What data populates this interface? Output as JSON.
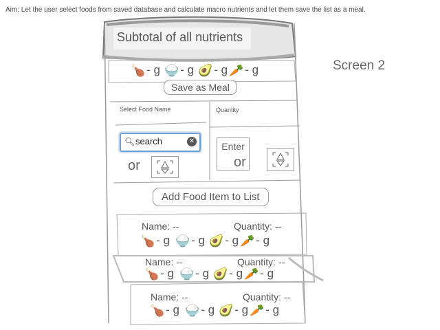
{
  "aim_text": "Aim: Let the user select foods from saved database and  calculate macro nutrients and let them save the list as a meal.",
  "screen_label": "Screen 2",
  "subtotal": {
    "title": "Subtotal   of all nutrients",
    "macros": [
      "- g",
      "- g",
      "- g",
      "- g"
    ]
  },
  "macro_icons": [
    "🍗",
    "🍚",
    "🥑",
    "🥕"
  ],
  "save_meal_label": "Save as Meal",
  "select_food_label": "Select Food  Name",
  "quantity_label": "Quantity",
  "search": {
    "placeholder": "search",
    "value": "search"
  },
  "or_label": "or",
  "enter_label": "Enter",
  "add_item_label": "Add Food Item to List",
  "food_items": [
    {
      "name_label": "Name:  --",
      "quantity_label": "Quantity: --",
      "macros": [
        "- g",
        "- g",
        "- g",
        "- g"
      ]
    },
    {
      "name_label": "Name:  --",
      "quantity_label": "Quantity: --",
      "macros": [
        "- g",
        "- g",
        "- g",
        "- g"
      ]
    },
    {
      "name_label": "Name:  --",
      "quantity_label": "Quantity: --",
      "macros": [
        "- g",
        "- g",
        "- g",
        "- g"
      ]
    }
  ]
}
